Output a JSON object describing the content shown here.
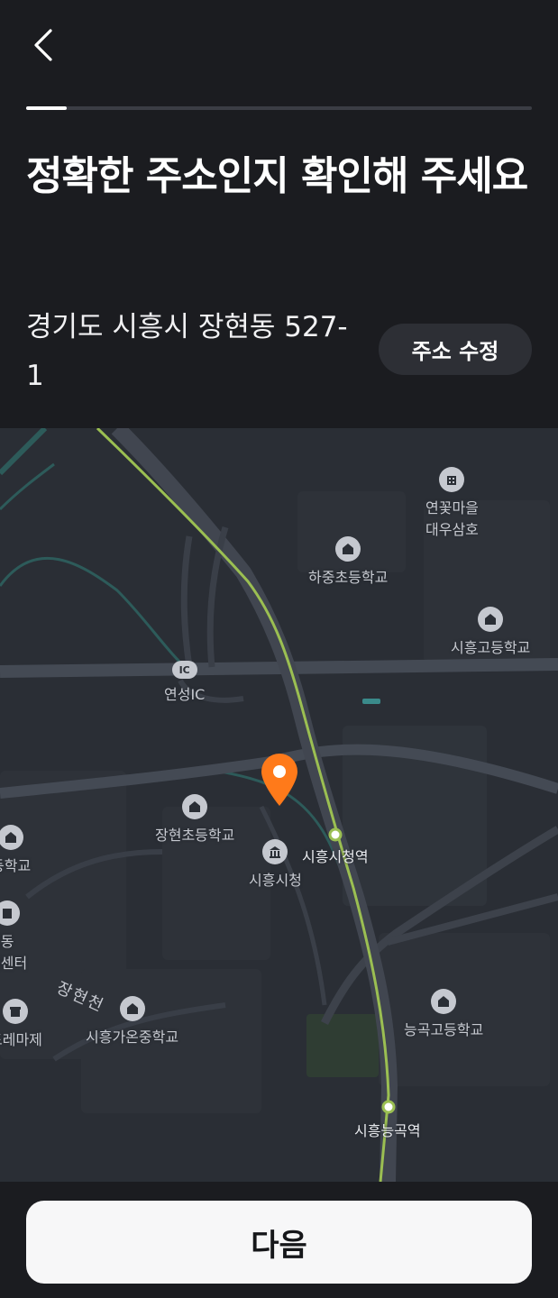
{
  "header": {
    "progress_percent": 8,
    "title": "정확한 주소인지 확인해 주세요",
    "address": "경기도 시흥시 장현동 527-1",
    "edit_label": "주소 수정"
  },
  "map": {
    "stream_label": "장현천",
    "ic_badge": "IC",
    "pois": {
      "yeonkkot": "연꽃마을\n대우삼호",
      "hajung": "하중초등학교",
      "siheung_high": "시흥고등학교",
      "yeonseong_ic": "연성IC",
      "janghyeon": "장현초등학교",
      "city_hall_station": "시흥시청역",
      "city_hall": "시흥시청",
      "left_school": "등학교",
      "left_center": "곡동\n지센터",
      "left_mart": "드레마제",
      "gaon": "시흥가온중학교",
      "neunggok_high": "능곡고등학교",
      "neunggok_station": "시흥능곡역"
    }
  },
  "footer": {
    "next_label": "다음"
  },
  "colors": {
    "background": "#1b1c20",
    "map_bg": "#2a2e35",
    "pin": "#ff7a1a",
    "rail": "#9bbf52"
  }
}
